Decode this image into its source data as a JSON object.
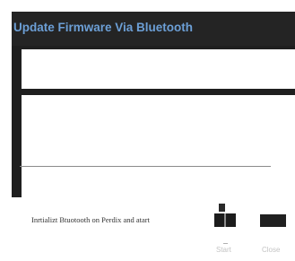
{
  "window": {
    "title": "Update Firmware Via Bluetooth"
  },
  "status": {
    "instruction": "Inrtializt Btuotooth on Perdix and atart"
  },
  "buttons": {
    "start_label": "Start",
    "close_label": "Close"
  },
  "icons": {
    "progress": "progress-icon"
  },
  "colors": {
    "title_text": "#6c9fd6",
    "window_background": "#1f1f1f",
    "button_fill": "#1c1c1c"
  }
}
